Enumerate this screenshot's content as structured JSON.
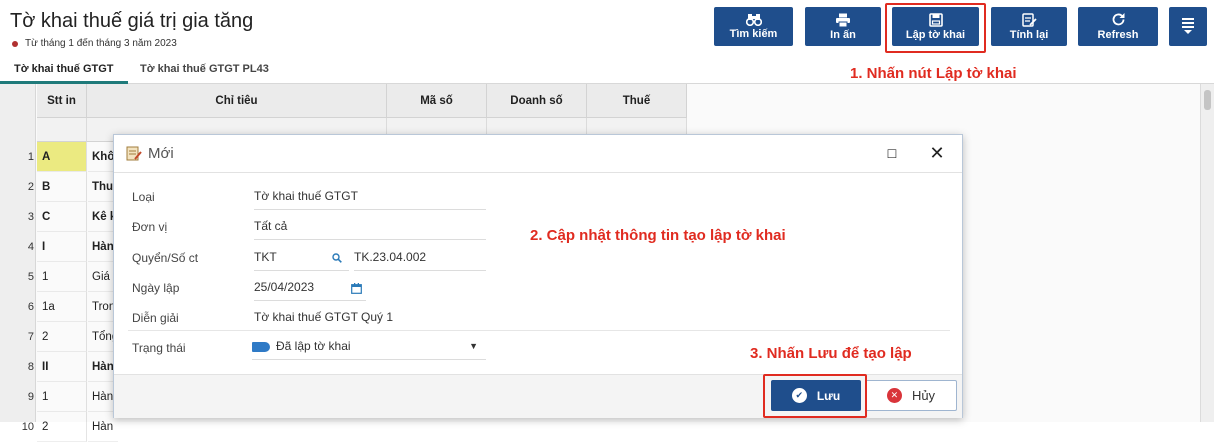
{
  "header": {
    "title": "Tờ khai thuế giá trị gia tăng",
    "subtitle": "Từ tháng 1 đến tháng 3 năm 2023",
    "buttons": [
      {
        "label": "Tìm kiếm",
        "icon": "binoculars-icon"
      },
      {
        "label": "In ấn",
        "icon": "printer-icon"
      },
      {
        "label": "Lập tờ khai",
        "icon": "save-icon"
      },
      {
        "label": "Tính lại",
        "icon": "edit-list-icon"
      },
      {
        "label": "Refresh",
        "icon": "refresh-icon"
      },
      {
        "label": "",
        "icon": "menu-icon"
      }
    ]
  },
  "annotations": {
    "step1": "1. Nhấn nút Lập tờ khai",
    "step2": "2. Cập nhật thông tin tạo lập tờ khai",
    "step3": "3. Nhấn Lưu để tạo lập"
  },
  "tabs": [
    "Tờ khai thuế GTGT",
    "Tờ khai thuế GTGT PL43"
  ],
  "grid": {
    "columns": [
      "Stt in",
      "Chỉ tiêu",
      "Mã số",
      "Doanh số",
      "Thuế"
    ],
    "rows": [
      {
        "num": "1",
        "stt": "A",
        "chi_tieu": "Khô",
        "bold": true
      },
      {
        "num": "2",
        "stt": "B",
        "chi_tieu": "Thu",
        "bold": true
      },
      {
        "num": "3",
        "stt": "C",
        "chi_tieu": "Kê k",
        "bold": true
      },
      {
        "num": "4",
        "stt": "I",
        "chi_tieu": "Hàn",
        "bold": true
      },
      {
        "num": "5",
        "stt": "1",
        "chi_tieu": "Giá",
        "bold": false
      },
      {
        "num": "6",
        "stt": "1a",
        "chi_tieu": "Tron",
        "bold": false
      },
      {
        "num": "7",
        "stt": "2",
        "chi_tieu": "Tổng",
        "bold": false
      },
      {
        "num": "8",
        "stt": "II",
        "chi_tieu": "Hàn",
        "bold": true
      },
      {
        "num": "9",
        "stt": "1",
        "chi_tieu": "Hàn",
        "bold": false
      },
      {
        "num": "10",
        "stt": "2",
        "chi_tieu": "Hàn",
        "bold": false
      }
    ]
  },
  "dialog": {
    "title": "Mới",
    "fields": {
      "loai_label": "Loại",
      "loai_value": "Tờ khai thuế GTGT",
      "donvi_label": "Đơn vị",
      "donvi_value": "Tất cả",
      "quyen_label": "Quyển/Số ct",
      "quyen_value": "TKT",
      "so_ct_value": "TK.23.04.002",
      "ngaylap_label": "Ngày lập",
      "ngaylap_value": "25/04/2023",
      "diengiai_label": "Diễn giải",
      "diengiai_value": "Tờ khai thuế GTGT Quý 1",
      "trangthai_label": "Trạng thái",
      "trangthai_value": "Đã lập tờ khai"
    },
    "save_label": "Lưu",
    "cancel_label": "Hủy"
  },
  "colors": {
    "primary": "#1f4e8c",
    "highlight": "#e02b20",
    "status_tag": "#2f7ac6",
    "row_highlight": "#f0ef84"
  }
}
